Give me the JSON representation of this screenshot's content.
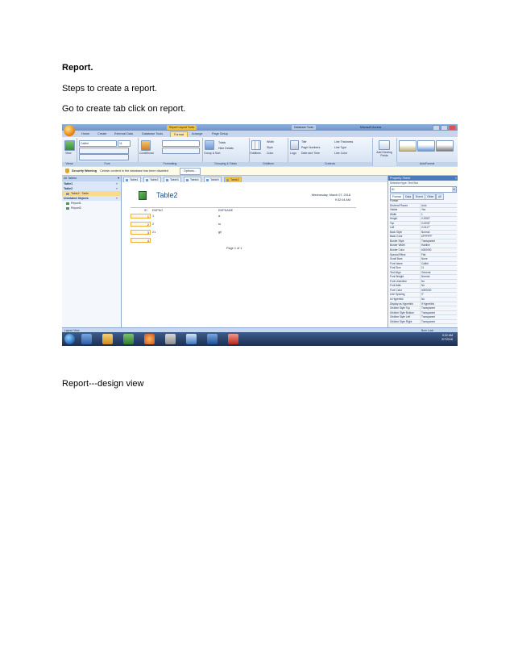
{
  "document": {
    "title": "Report.",
    "steps": "Steps to create a report.",
    "instruction": "Go to create tab click on report.",
    "caption_design": "Report---design view"
  },
  "screenshot": {
    "window_title": "Microsoft Access",
    "context_tabs": [
      "Report Layout Tools",
      "Database Tools"
    ],
    "ribbon_tabs": [
      "Home",
      "Create",
      "External Data",
      "Database Tools",
      "Format",
      "Arrange",
      "Page Setup"
    ],
    "active_ribbon_tab": "Format",
    "ribbon_groups": {
      "views": "Views",
      "font": "Font",
      "formatting": "Formatting",
      "grouping": "Grouping & Totals",
      "gridlines": "Gridlines",
      "controls": "Controls",
      "autoformat": "AutoFormat"
    },
    "ribbon_labels": {
      "view": "View",
      "font_name": "Calibri",
      "font_size": "11",
      "conditional": "Conditional",
      "group_sort": "Group & Sort",
      "totals": "Totals",
      "hide_details": "Hide Details",
      "gridlines_btn": "Gridlines",
      "width": "Width",
      "style": "Style",
      "color": "Color",
      "logo": "Logo",
      "title": "Title",
      "page_numbers": "Page Numbers",
      "date_time": "Date and Time",
      "line_thickness": "Line Thickness",
      "line_type": "Line Type",
      "line_color": "Line Color",
      "add_fields": "Add Existing Fields"
    },
    "security_warning": {
      "label": "Security Warning",
      "message": "Certain content in the database has been disabled",
      "button": "Options..."
    },
    "nav_pane": {
      "header": "All Tables",
      "items": [
        {
          "label": "Table1",
          "type": "group"
        },
        {
          "label": "Table2",
          "type": "group"
        },
        {
          "label": "Table2 : Table",
          "type": "sub",
          "selected": true
        },
        {
          "label": "Unrelated Objects",
          "type": "group"
        },
        {
          "label": "Report1",
          "type": "sub"
        },
        {
          "label": "Report2",
          "type": "sub"
        }
      ]
    },
    "doc_tabs": [
      "Table1",
      "Table2",
      "Table3",
      "Table4",
      "Table5",
      "Table2"
    ],
    "active_doc_tab": 5,
    "report": {
      "title": "Table2",
      "date": "Wednesday, March 07, 2018",
      "time": "9:32:04 AM",
      "columns": [
        "ID",
        "EMPNO",
        "EMPNAME"
      ],
      "rows": [
        {
          "id": "1",
          "empno": "1",
          "empname": "a"
        },
        {
          "id": "2",
          "empno": "2",
          "empname": "sr"
        },
        {
          "id": "3",
          "empno": "21",
          "empname": "gh"
        },
        {
          "id": "4",
          "empno": "",
          "empname": ""
        }
      ],
      "page_footer": "Page 1 of 1"
    },
    "property_sheet": {
      "header": "Property Sheet",
      "selection_type": "Selection type: Text Box",
      "selected_object": "ID",
      "tabs": [
        "Format",
        "Data",
        "Event",
        "Other",
        "All"
      ],
      "properties": [
        [
          "Format",
          ""
        ],
        [
          "Decimal Places",
          "Auto"
        ],
        [
          "Visible",
          "Yes"
        ],
        [
          "Width",
          "1"
        ],
        [
          "Height",
          "0.2083\""
        ],
        [
          "Top",
          "0.0208\""
        ],
        [
          "Left",
          "0.0417\""
        ],
        [
          "Back Style",
          "Normal"
        ],
        [
          "Back Color",
          "#FFFFFF"
        ],
        [
          "Border Style",
          "Transparent"
        ],
        [
          "Border Width",
          "Hairline"
        ],
        [
          "Border Color",
          "#000000"
        ],
        [
          "Special Effect",
          "Flat"
        ],
        [
          "Scroll Bars",
          "None"
        ],
        [
          "Font Name",
          "Calibri"
        ],
        [
          "Font Size",
          "11"
        ],
        [
          "Text Align",
          "General"
        ],
        [
          "Font Weight",
          "Normal"
        ],
        [
          "Font Underline",
          "No"
        ],
        [
          "Font Italic",
          "No"
        ],
        [
          "Fore Color",
          "#000000"
        ],
        [
          "Line Spacing",
          "0\""
        ],
        [
          "Is Hyperlink",
          "No"
        ],
        [
          "Display as Hyperlink",
          "If Hyperlink"
        ],
        [
          "Gridline Style Top",
          "Transparent"
        ],
        [
          "Gridline Style Bottom",
          "Transparent"
        ],
        [
          "Gridline Style Left",
          "Transparent"
        ],
        [
          "Gridline Style Right",
          "Transparent"
        ]
      ]
    },
    "status_left": "Layout View",
    "status_right": "Num Lock",
    "clock_time": "9:32 AM",
    "clock_date": "3/7/2018"
  },
  "colors": {
    "ribbon_active": "#fbe6a4",
    "report_title": "#1f4e86",
    "taskbar": "#1c2f52"
  }
}
